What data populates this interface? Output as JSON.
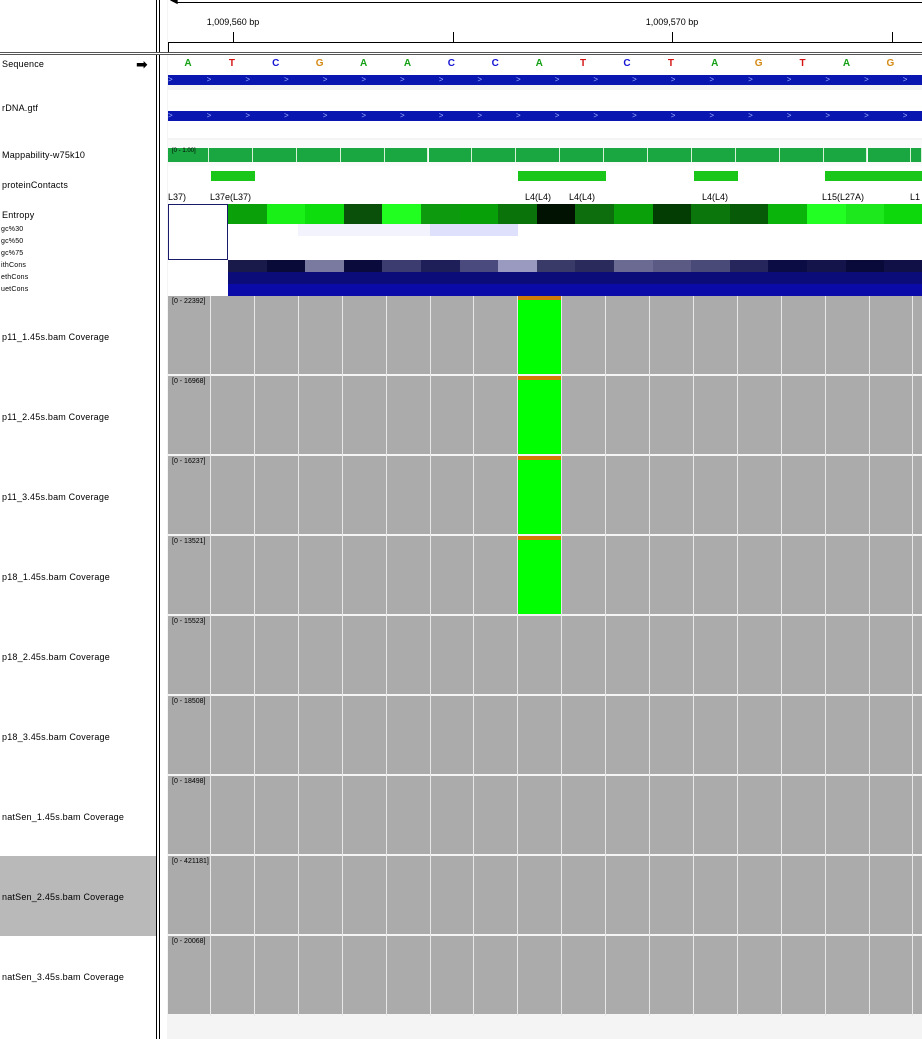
{
  "ruler": {
    "labels": [
      "1,009,560 bp",
      "1,009,570 bp"
    ]
  },
  "sequence": {
    "bases": [
      "A",
      "T",
      "C",
      "G",
      "A",
      "A",
      "C",
      "C",
      "A",
      "T",
      "C",
      "T",
      "A",
      "G",
      "T",
      "A",
      "G"
    ],
    "colors": {
      "A": "#14a014",
      "T": "#d41414",
      "C": "#1414d4",
      "G": "#d48a14"
    }
  },
  "tracks": {
    "sequence": "Sequence",
    "rdna": "rDNA.gtf",
    "mappability": "Mappability-w75k10",
    "mappability_range": "[0 - 1.00]",
    "protein_contacts": "proteinContacts",
    "entropy": "Entropy",
    "gc30": "gc%30",
    "gc50": "gc%50",
    "gc75": "gc%75",
    "ithcons": "ithCons",
    "ethcons": "ethCons",
    "uetcons": "uetCons"
  },
  "contact_labels": [
    "L37)",
    "L37e(L37)",
    "L4(L4)",
    "L4(L4)",
    "L4(L4)",
    "L15(L27A)",
    "L1"
  ],
  "coverage_tracks": [
    {
      "name": "p11_1.45s.bam Coverage",
      "range": "[0 - 22392]",
      "highlight": true
    },
    {
      "name": "p11_2.45s.bam Coverage",
      "range": "[0 - 16968]",
      "highlight": true
    },
    {
      "name": "p11_3.45s.bam Coverage",
      "range": "[0 - 16237]",
      "highlight": true
    },
    {
      "name": "p18_1.45s.bam Coverage",
      "range": "[0 - 13521]",
      "highlight": true
    },
    {
      "name": "p18_2.45s.bam Coverage",
      "range": "[0 - 15523]",
      "highlight": false
    },
    {
      "name": "p18_3.45s.bam Coverage",
      "range": "[0 - 18508]",
      "highlight": false
    },
    {
      "name": "natSen_1.45s.bam Coverage",
      "range": "[0 - 18498]",
      "highlight": false
    },
    {
      "name": "natSen_2.45s.bam Coverage",
      "range": "[0 - 421181]",
      "highlight": false
    },
    {
      "name": "natSen_3.45s.bam Coverage",
      "range": "[0 - 20068]",
      "highlight": false
    }
  ],
  "colors": {
    "coverage_bg": "#ababab",
    "allele_highlight": "#00ff00",
    "mismatch_top": "#d07a08",
    "feature_blue": "#0a16b0",
    "mappability_green": "#1aa640"
  }
}
